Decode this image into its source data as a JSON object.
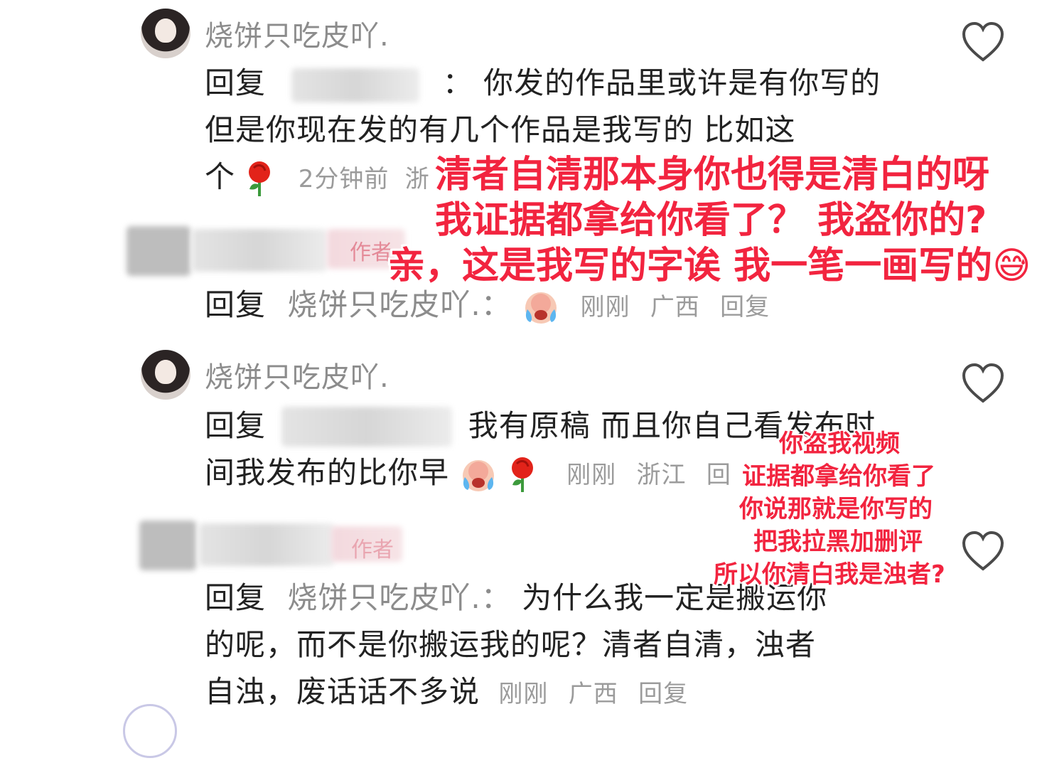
{
  "comments": [
    {
      "username": "烧饼只吃皮吖.",
      "reply_prefix": "回复",
      "colon": "：",
      "line1": "你发的作品里或许是有你写的",
      "line2": "但是你现在发的有几个作品是我写的 比如这",
      "line3": "个",
      "time": "2分钟前",
      "location": "浙"
    },
    {
      "author_tag": "作者",
      "reply_prefix": "回复",
      "reply_target": "烧饼只吃皮吖.：",
      "time": "刚刚",
      "location": "广西",
      "reply_button": "回复"
    },
    {
      "username": "烧饼只吃皮吖.",
      "reply_prefix": "回复",
      "line1": "我有原稿 而且你自己看发布时",
      "line2": "间我发布的比你早",
      "time": "刚刚",
      "location": "浙江",
      "reply_button": "回"
    },
    {
      "author_tag": "作者",
      "reply_prefix": "回复",
      "reply_target": "烧饼只吃皮吖.：",
      "line1": "为什么我一定是搬运你",
      "line2": "的呢，而不是你搬运我的呢？清者自清，浊者",
      "line3": "自浊，废话话不多说",
      "time": "刚刚",
      "location": "广西",
      "reply_button": "回复"
    }
  ],
  "annotations": {
    "top": [
      "清者自清那本身你也得是清白的呀",
      "我证据都拿给你看了？ 我盗你的?",
      "亲，这是我写的字诶 我一笔一画写的😅"
    ],
    "side": [
      "你盗我视频",
      "证据都拿给你看了",
      "你说那就是你写的",
      "把我拉黑加删评",
      "所以你清白我是浊者?"
    ],
    "color": "#f2243f"
  },
  "icons": {
    "like": "heart-outline-icon",
    "rose": "rose-emoji-icon",
    "cry": "crying-face-emoji-icon"
  }
}
